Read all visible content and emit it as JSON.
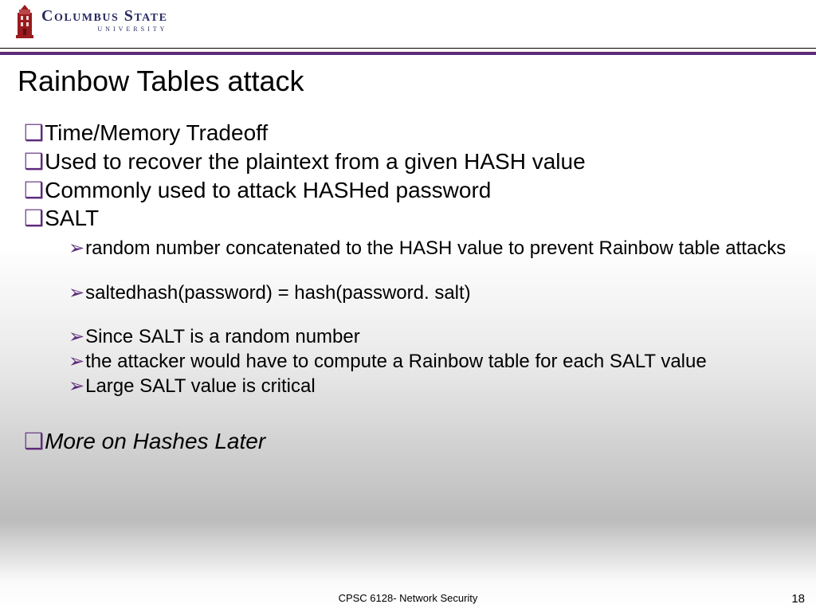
{
  "logo": {
    "line1a": "Columbus",
    "line1b": "State",
    "line2": "UNIVERSITY"
  },
  "title": "Rainbow Tables attack",
  "bullets": {
    "b1": "Time/Memory Tradeoff",
    "b2": "Used to recover the plaintext from a given HASH value",
    "b3": "Commonly used to attack HASHed password",
    "b4": "SALT",
    "s1": "random number concatenated to the HASH value to prevent Rainbow table attacks",
    "s2": "saltedhash(password) = hash(password. salt)",
    "s3": "Since SALT is a random number",
    "s4": "the attacker would have to compute a Rainbow table for each SALT value",
    "s5": "Large SALT value is critical",
    "b5": "More on Hashes Later"
  },
  "glyphs": {
    "square": "❑",
    "arrow": "➢"
  },
  "footer": {
    "course": "CPSC 6128- Network Security",
    "slide_number": "18"
  }
}
